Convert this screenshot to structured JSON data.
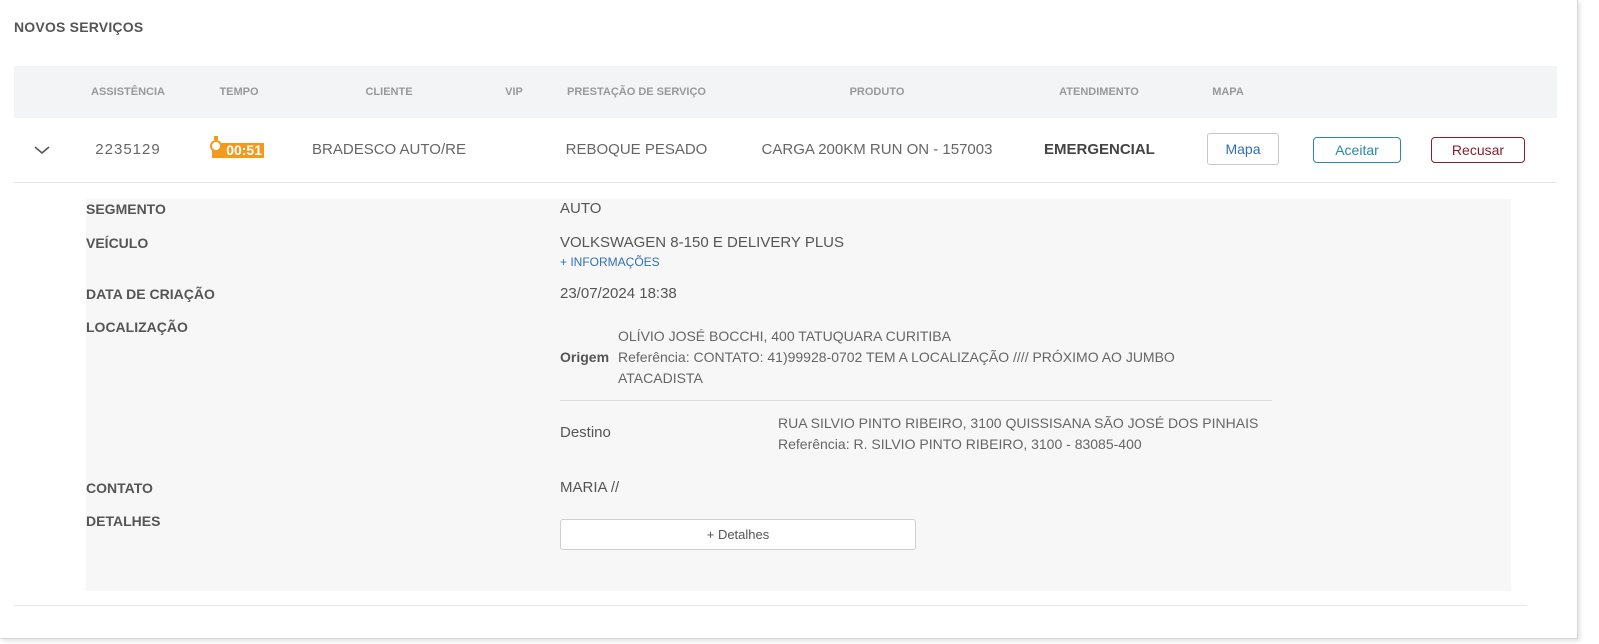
{
  "panel": {
    "title": "NOVOS SERVIÇOS"
  },
  "table": {
    "headers": {
      "assistencia": "ASSISTÊNCIA",
      "tempo": "TEMPO",
      "cliente": "CLIENTE",
      "vip": "VIP",
      "prestacao": "PRESTAÇÃO DE SERVIÇO",
      "produto": "PRODUTO",
      "atendimento": "ATENDIMENTO",
      "mapa": "MAPA"
    },
    "row": {
      "assistencia": "2235129",
      "tempo": "00:51",
      "cliente": "BRADESCO AUTO/RE",
      "vip": "",
      "prestacao": "REBOQUE PESADO",
      "produto": "CARGA 200KM RUN ON - 157003",
      "atendimento": "EMERGENCIAL",
      "mapa_button": "Mapa",
      "accept_button": "Aceitar",
      "reject_button": "Recusar"
    }
  },
  "details": {
    "segmento_label": "SEGMENTO",
    "segmento_value": "AUTO",
    "veiculo_label": "VEÍCULO",
    "veiculo_value": "VOLKSWAGEN 8-150 E DELIVERY PLUS",
    "more_info_link": "+ INFORMAÇÕES",
    "data_label": "DATA DE CRIAÇÃO",
    "data_value": "23/07/2024 18:38",
    "localizacao_label": "LOCALIZAÇÃO",
    "origem": {
      "label": "Origem",
      "address": "OLÍVIO JOSÉ BOCCHI, 400 TATUQUARA CURITIBA",
      "reference_line1": "Referência: CONTATO: 41)99928-0702 TEM A LOCALIZAÇÃO //// PRÓXIMO AO JUMBO",
      "reference_line2": "ATACADISTA"
    },
    "destino": {
      "label": "Destino",
      "address": "RUA SILVIO PINTO RIBEIRO, 3100 QUISSISANA SÃO JOSÉ DOS PINHAIS",
      "reference": "Referência: R. SILVIO PINTO RIBEIRO, 3100 - 83085-400"
    },
    "contato_label": "CONTATO",
    "contato_value": "MARIA //",
    "detalhes_label": "DETALHES",
    "detalhes_button": "+ Detalhes"
  },
  "colors": {
    "timer": "#f39a1e",
    "link": "#2f6fb8",
    "accept": "#2a8aa6",
    "reject": "#8b1e2d"
  },
  "icons": {
    "expand": "chevron-down-icon",
    "timer": "stopwatch-icon"
  }
}
